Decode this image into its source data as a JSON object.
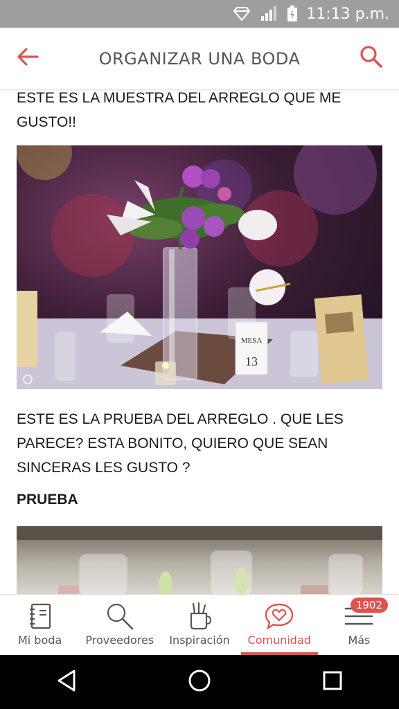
{
  "status_bar": {
    "time": "11:13 p.m.",
    "icons": [
      "data-saver-icon",
      "signal-icon",
      "battery-icon"
    ]
  },
  "app_bar": {
    "title": "ORGANIZAR UNA BODA",
    "back_icon": "arrow-left-icon",
    "search_icon": "search-icon",
    "accent": "#e0524e"
  },
  "post": {
    "paragraph_1": "ESTE ES LA MUESTRA DEL ARREGLO QUE ME GUSTO!!",
    "paragraph_2": "ESTE ES LA PRUEBA DEL ARREGLO . QUE LES PARECE? ESTA BONITO, QUIERO QUE SEAN SINCERAS LES GUSTO ?",
    "heading": "PRUEBA",
    "photo_1_card_text": "MESA 13"
  },
  "bottom_nav": {
    "items": [
      {
        "label": "Mi boda",
        "icon": "notebook-icon"
      },
      {
        "label": "Proveedores",
        "icon": "magnifier-icon"
      },
      {
        "label": "Inspiración",
        "icon": "cup-brushes-icon"
      },
      {
        "label": "Comunidad",
        "icon": "heart-chat-icon",
        "active": true
      },
      {
        "label": "Más",
        "icon": "menu-icon",
        "badge": "1902"
      }
    ]
  },
  "system_nav": [
    "back-triangle-icon",
    "home-circle-icon",
    "recents-square-icon"
  ]
}
